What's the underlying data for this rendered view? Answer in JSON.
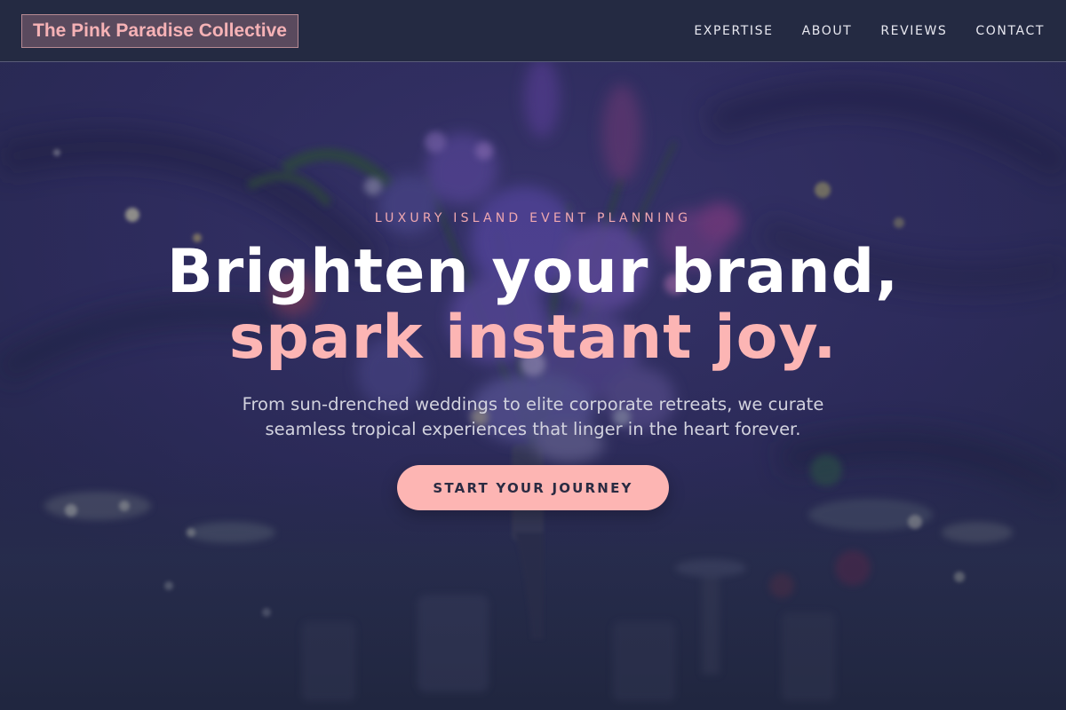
{
  "header": {
    "brand": "The Pink Paradise Collective",
    "nav": [
      {
        "label": "EXPERTISE"
      },
      {
        "label": "ABOUT"
      },
      {
        "label": "REVIEWS"
      },
      {
        "label": "CONTACT"
      }
    ]
  },
  "hero": {
    "eyebrow": "LUXURY ISLAND EVENT PLANNING",
    "title_line1": "Brighten your brand,",
    "title_line2": "spark instant joy.",
    "subtitle": "From sun-drenched weddings to elite corporate retreats, we curate seamless tropical experiences that linger in the heart forever.",
    "cta_label": "START YOUR JOURNEY",
    "background": "dim photo of a purple floral centerpiece on a banquet table"
  },
  "colors": {
    "header_bg": "#242a42",
    "accent_pink": "#fcb5b4",
    "eyebrow_pink": "#f0a8b0",
    "page_bg": "#2b2b55"
  }
}
